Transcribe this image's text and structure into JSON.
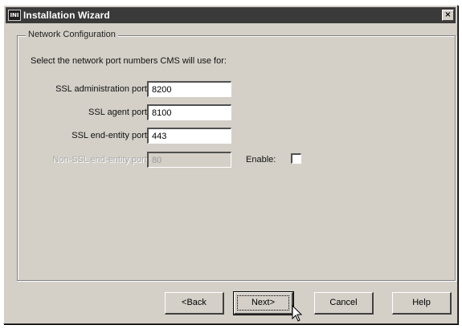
{
  "window": {
    "title": "Installation Wizard",
    "app_icon_text": "INI",
    "close_glyph": "×"
  },
  "group": {
    "legend": "Network Configuration",
    "instruction": "Select the network port numbers CMS will use for:"
  },
  "fields": [
    {
      "label": "SSL administration port",
      "value": "8200",
      "enabled": true
    },
    {
      "label": "SSL agent port",
      "value": "8100",
      "enabled": true
    },
    {
      "label": "SSL end-entity port",
      "value": "443",
      "enabled": true
    },
    {
      "label": "Non-SSL end-entity port",
      "value": "80",
      "enabled": false
    }
  ],
  "enable_checkbox": {
    "label": "Enable:",
    "checked": false
  },
  "buttons": {
    "back": "<Back",
    "next": "Next>",
    "cancel": "Cancel",
    "help": "Help"
  },
  "icons": {
    "cursor": "mouse-pointer-icon"
  }
}
